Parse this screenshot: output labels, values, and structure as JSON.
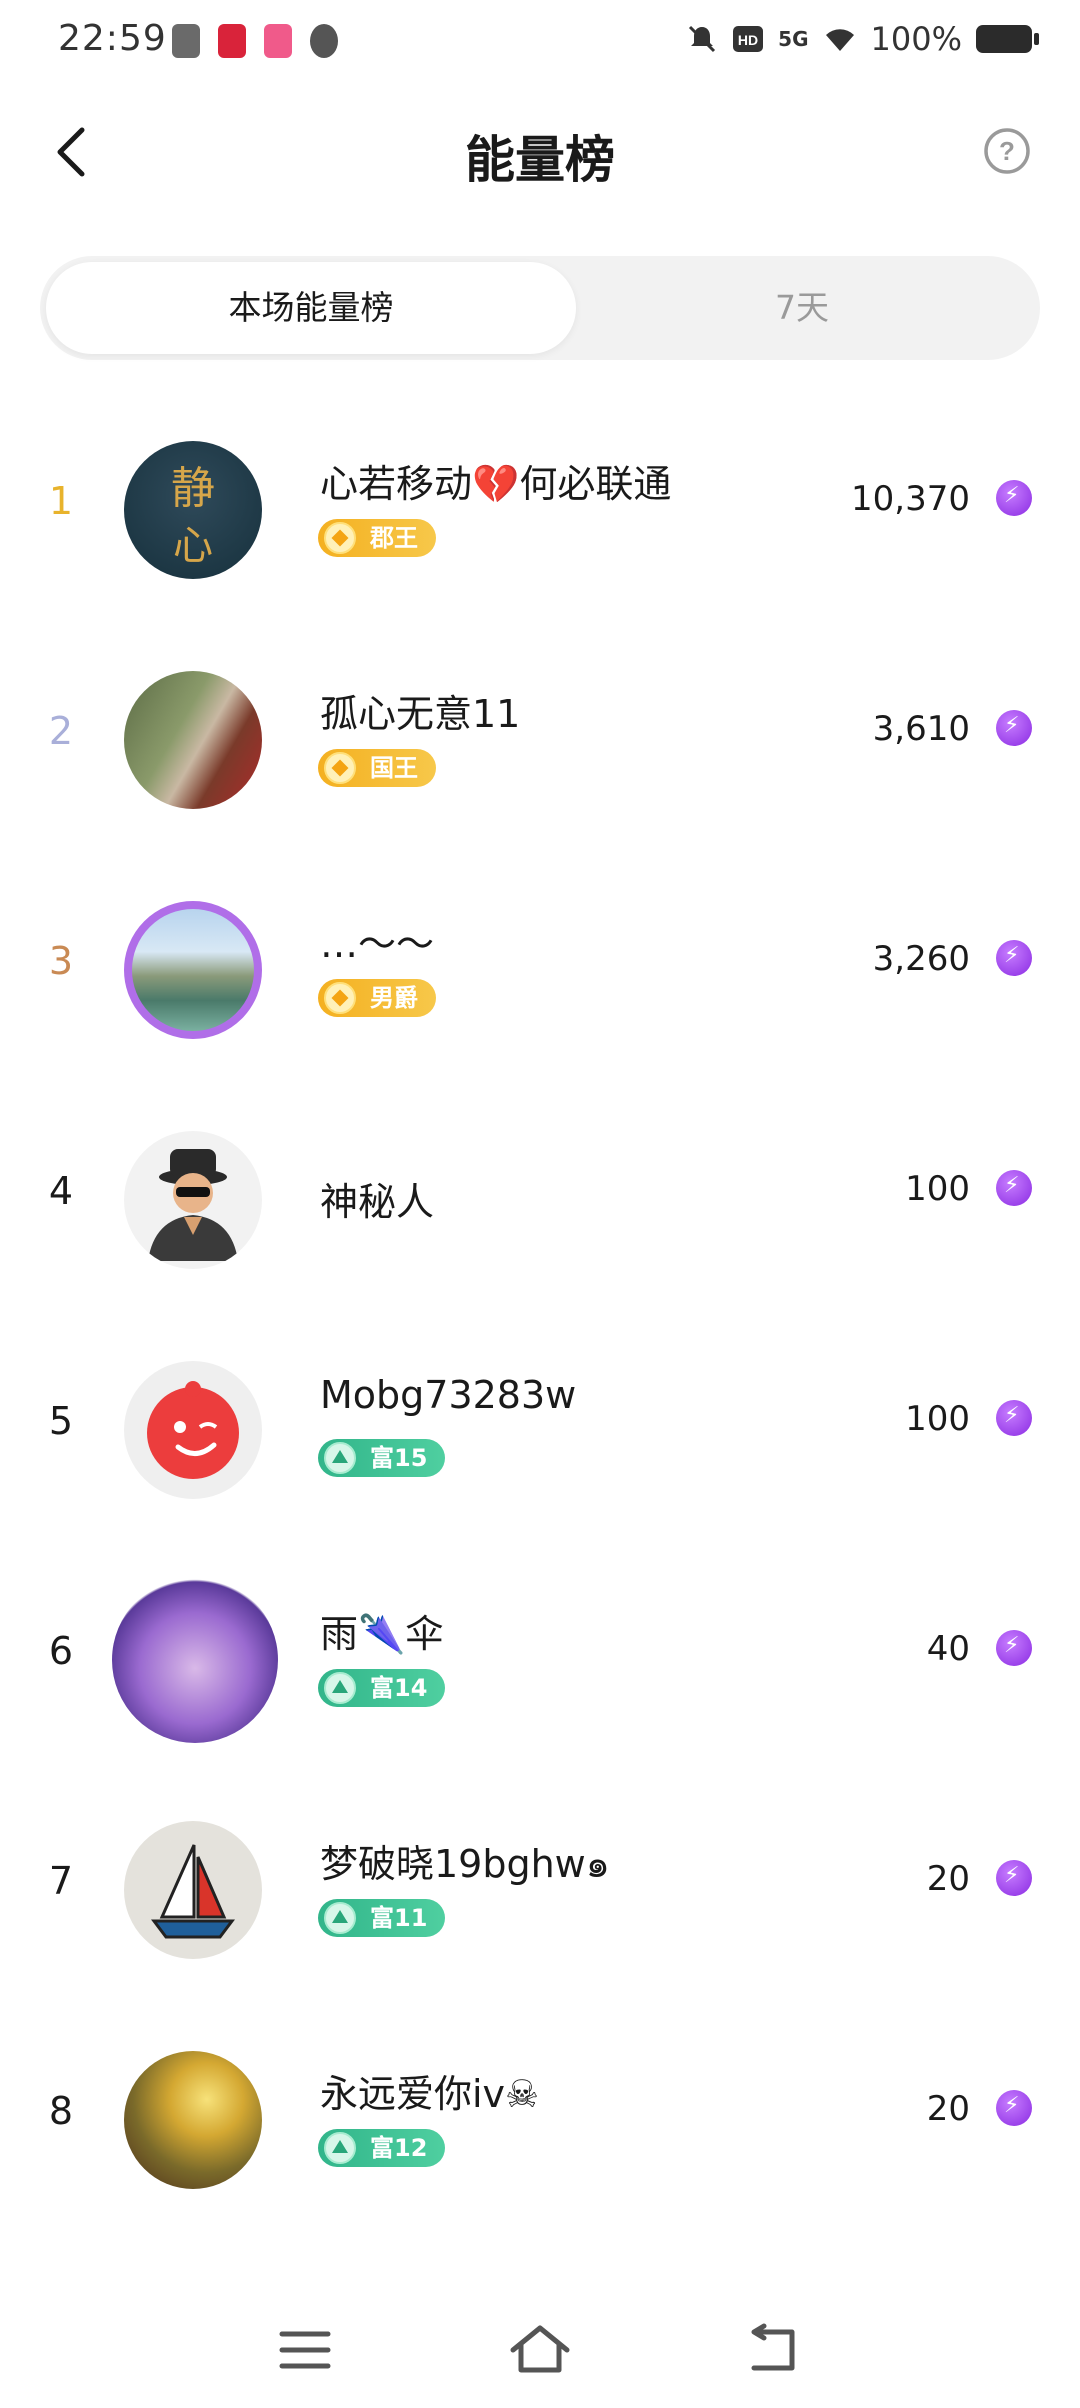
{
  "status_bar": {
    "time": "22:59",
    "network": "5G",
    "battery": "100%"
  },
  "header": {
    "title": "能量榜"
  },
  "tabs": [
    {
      "label": "本场能量榜",
      "active": true
    },
    {
      "label": "7天",
      "active": false
    }
  ],
  "ranking": [
    {
      "rank": "1",
      "name": "心若移动💔何必联通",
      "badge": "郡王",
      "badge_type": "gold",
      "score": "10,370",
      "avatar_icon": "calligraphy-avatar"
    },
    {
      "rank": "2",
      "name": "孤心无意11",
      "badge": "国王",
      "badge_type": "gold",
      "score": "3,610",
      "avatar_icon": "portrait-avatar"
    },
    {
      "rank": "3",
      "name": "…～～",
      "badge": "男爵",
      "badge_type": "gold",
      "score": "3,260",
      "avatar_icon": "landscape-avatar"
    },
    {
      "rank": "4",
      "name": "神秘人",
      "badge": "",
      "badge_type": "none",
      "score": "100",
      "avatar_icon": "mystery-man-avatar"
    },
    {
      "rank": "5",
      "name": "Mobg73283w",
      "badge": "富15",
      "badge_type": "green",
      "score": "100",
      "avatar_icon": "wink-face-avatar"
    },
    {
      "rank": "6",
      "name": "雨🌂伞",
      "badge": "富14",
      "badge_type": "green",
      "score": "40",
      "avatar_icon": "crest-avatar"
    },
    {
      "rank": "7",
      "name": "梦破晓19bghw๑",
      "badge": "富11",
      "badge_type": "green",
      "score": "20",
      "avatar_icon": "sailboat-avatar"
    },
    {
      "rank": "8",
      "name": "永远爱你iv☠",
      "badge": "富12",
      "badge_type": "green",
      "score": "20",
      "avatar_icon": "forest-avatar"
    }
  ],
  "colors": {
    "rank1": "#e8b32c",
    "rank2": "#a9afd9",
    "rank3": "#c98a54",
    "default_rank": "#1a1a1a",
    "energy_icon": "#8a2be2"
  },
  "nav_bar": {
    "icons": [
      "menu-icon",
      "home-icon",
      "back-icon"
    ]
  }
}
